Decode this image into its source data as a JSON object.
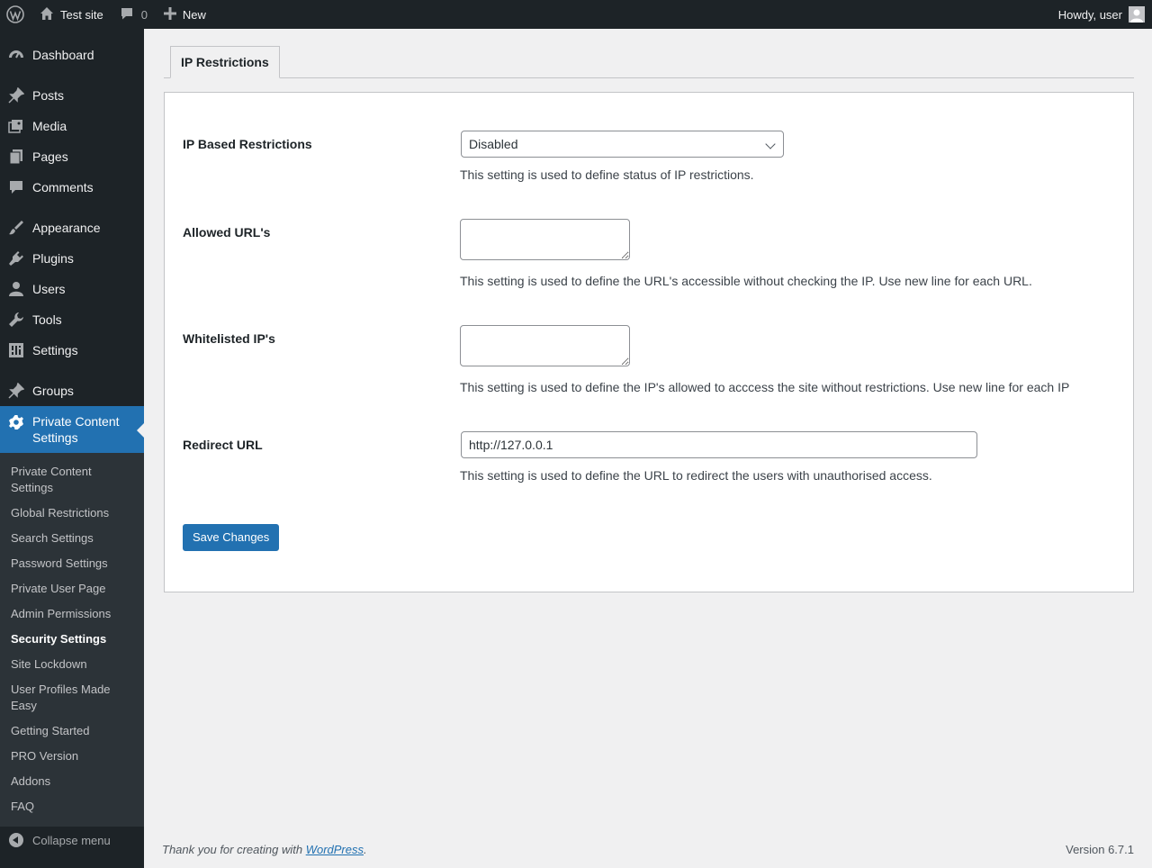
{
  "adminbar": {
    "site_name": "Test site",
    "comments_count": "0",
    "new_label": "New",
    "howdy": "Howdy, user"
  },
  "sidebar": {
    "items": [
      {
        "label": "Dashboard",
        "icon": "dashboard-icon"
      },
      {
        "label": "Posts",
        "icon": "pin-icon"
      },
      {
        "label": "Media",
        "icon": "media-icon"
      },
      {
        "label": "Pages",
        "icon": "pages-icon"
      },
      {
        "label": "Comments",
        "icon": "comment-icon"
      },
      {
        "label": "Appearance",
        "icon": "brush-icon"
      },
      {
        "label": "Plugins",
        "icon": "plug-icon"
      },
      {
        "label": "Users",
        "icon": "user-icon"
      },
      {
        "label": "Tools",
        "icon": "wrench-icon"
      },
      {
        "label": "Settings",
        "icon": "settings-icon"
      },
      {
        "label": "Groups",
        "icon": "pin-icon"
      },
      {
        "label": "Private Content Settings",
        "icon": "gear-icon"
      }
    ],
    "submenu": [
      "Private Content Settings",
      "Global Restrictions",
      "Search Settings",
      "Password Settings",
      "Private User Page",
      "Admin Permissions",
      "Security Settings",
      "Site Lockdown",
      "User Profiles Made Easy",
      "Getting Started",
      "PRO Version",
      "Addons",
      "FAQ"
    ],
    "current_submenu": "Security Settings",
    "collapse_label": "Collapse menu"
  },
  "tabs": [
    {
      "label": "IP Restrictions",
      "active": true
    }
  ],
  "form": {
    "ip_restrictions": {
      "label": "IP Based Restrictions",
      "value": "Disabled",
      "description": "This setting is used to define status of IP restrictions."
    },
    "allowed_urls": {
      "label": "Allowed URL's",
      "value": "",
      "description": "This setting is used to define the URL's accessible without checking the IP. Use new line for each URL."
    },
    "whitelisted_ips": {
      "label": "Whitelisted IP's",
      "value": "",
      "description": "This setting is used to define the IP's allowed to acccess the site without restrictions. Use new line for each IP"
    },
    "redirect_url": {
      "label": "Redirect URL",
      "value": "http://127.0.0.1",
      "description": "This setting is used to define the URL to redirect the users with unauthorised access."
    },
    "save_label": "Save Changes"
  },
  "footer": {
    "thanks_prefix": "Thank you for creating with ",
    "thanks_link": "WordPress",
    "thanks_suffix": ".",
    "version": "Version 6.7.1"
  },
  "colors": {
    "adminbar_bg": "#1d2327",
    "accent": "#2271b1",
    "submenu_bg": "#2c3338",
    "page_bg": "#f0f0f1"
  }
}
